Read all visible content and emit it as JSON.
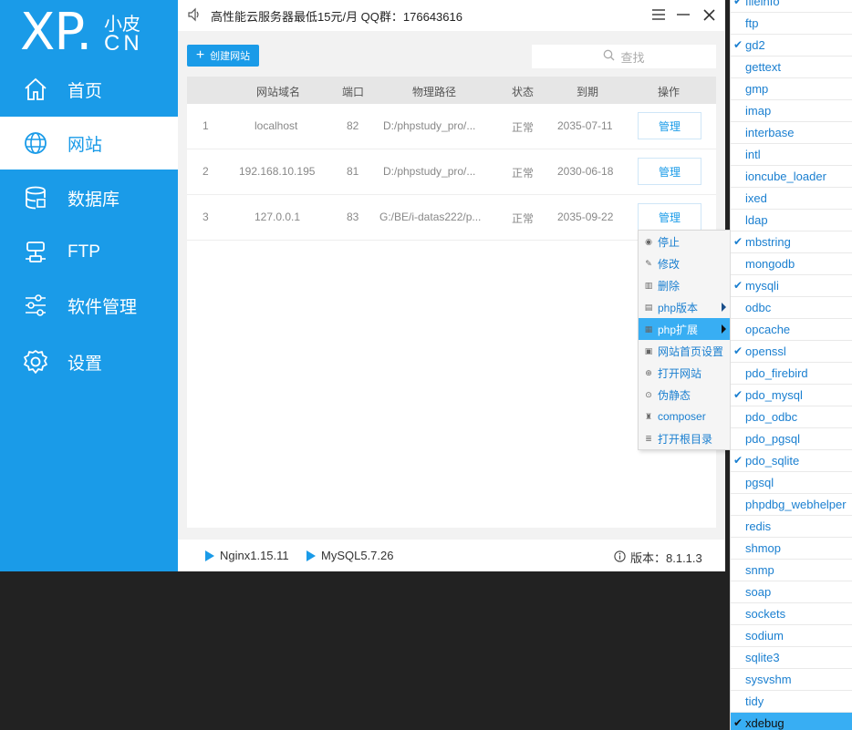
{
  "logo": {
    "xp": "XP.",
    "cn_top": "小皮",
    "cn_bottom": "CN"
  },
  "nav": [
    {
      "label": "首页",
      "icon": "home-icon"
    },
    {
      "label": "网站",
      "icon": "globe-icon",
      "active": true
    },
    {
      "label": "数据库",
      "icon": "database-icon"
    },
    {
      "label": "FTP",
      "icon": "server-icon"
    },
    {
      "label": "软件管理",
      "icon": "sliders-icon"
    },
    {
      "label": "设置",
      "icon": "gear-icon"
    }
  ],
  "titlebar": {
    "announce": "高性能云服务器最低15元/月   QQ群：176643616"
  },
  "toolbar": {
    "create_label": "创建网站",
    "search_placeholder": "查找"
  },
  "table": {
    "headers": [
      "网站域名",
      "端口",
      "物理路径",
      "状态",
      "到期",
      "操作"
    ],
    "rows": [
      {
        "no": "1",
        "domain": "localhost",
        "port": "82",
        "path": "D:/phpstudy_pro/...",
        "status": "正常",
        "expire": "2035-07-11",
        "action": "管理"
      },
      {
        "no": "2",
        "domain": "192.168.10.195",
        "port": "81",
        "path": "D:/phpstudy_pro/...",
        "status": "正常",
        "expire": "2030-06-18",
        "action": "管理"
      },
      {
        "no": "3",
        "domain": "127.0.0.1",
        "port": "83",
        "path": "G:/BE/i-datas222/p...",
        "status": "正常",
        "expire": "2035-09-22",
        "action": "管理"
      }
    ]
  },
  "statusbar": {
    "nginx": "Nginx1.15.11",
    "mysql": "MySQL5.7.26",
    "version": "版本：8.1.1.3"
  },
  "context_menu": [
    {
      "label": "停止",
      "icon": "stop-icon"
    },
    {
      "label": "修改",
      "icon": "edit-icon"
    },
    {
      "label": "删除",
      "icon": "trash-icon"
    },
    {
      "label": "php版本",
      "icon": "php-version-icon",
      "submenu": true
    },
    {
      "label": "php扩展",
      "icon": "php-extension-icon",
      "submenu": true,
      "highlighted": true
    },
    {
      "label": "网站首页设置",
      "icon": "homepage-settings-icon"
    },
    {
      "label": "打开网站",
      "icon": "open-site-icon"
    },
    {
      "label": "伪静态",
      "icon": "rewrite-icon"
    },
    {
      "label": "composer",
      "icon": "composer-icon"
    },
    {
      "label": "打开根目录",
      "icon": "open-folder-icon"
    }
  ],
  "extensions": [
    {
      "name": "fileinfo",
      "checked": true
    },
    {
      "name": "ftp",
      "checked": false
    },
    {
      "name": "gd2",
      "checked": true
    },
    {
      "name": "gettext",
      "checked": false
    },
    {
      "name": "gmp",
      "checked": false
    },
    {
      "name": "imap",
      "checked": false
    },
    {
      "name": "interbase",
      "checked": false
    },
    {
      "name": "intl",
      "checked": false
    },
    {
      "name": "ioncube_loader",
      "checked": false
    },
    {
      "name": "ixed",
      "checked": false
    },
    {
      "name": "ldap",
      "checked": false
    },
    {
      "name": "mbstring",
      "checked": true
    },
    {
      "name": "mongodb",
      "checked": false
    },
    {
      "name": "mysqli",
      "checked": true
    },
    {
      "name": "odbc",
      "checked": false
    },
    {
      "name": "opcache",
      "checked": false
    },
    {
      "name": "openssl",
      "checked": true
    },
    {
      "name": "pdo_firebird",
      "checked": false
    },
    {
      "name": "pdo_mysql",
      "checked": true
    },
    {
      "name": "pdo_odbc",
      "checked": false
    },
    {
      "name": "pdo_pgsql",
      "checked": false
    },
    {
      "name": "pdo_sqlite",
      "checked": true
    },
    {
      "name": "pgsql",
      "checked": false
    },
    {
      "name": "phpdbg_webhelper",
      "checked": false
    },
    {
      "name": "redis",
      "checked": false
    },
    {
      "name": "shmop",
      "checked": false
    },
    {
      "name": "snmp",
      "checked": false
    },
    {
      "name": "soap",
      "checked": false
    },
    {
      "name": "sockets",
      "checked": false
    },
    {
      "name": "sodium",
      "checked": false
    },
    {
      "name": "sqlite3",
      "checked": false
    },
    {
      "name": "sysvshm",
      "checked": false
    },
    {
      "name": "tidy",
      "checked": false
    },
    {
      "name": "xdebug",
      "checked": true,
      "highlighted": true
    }
  ],
  "colors": {
    "accent": "#1a9be8",
    "highlight": "#38aef3",
    "link": "#1a7fd0"
  }
}
